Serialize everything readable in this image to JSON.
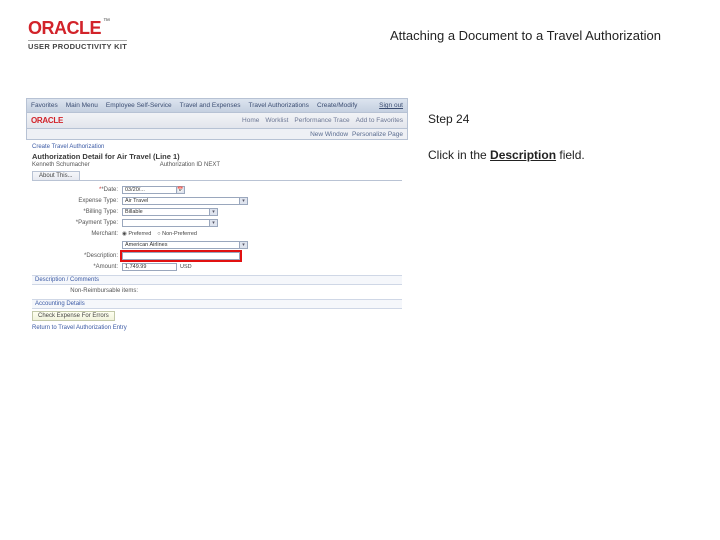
{
  "brand": {
    "name": "ORACLE",
    "tm": "™",
    "kit": "USER PRODUCTIVITY KIT"
  },
  "doc_title": "Attaching a Document to a Travel Authorization",
  "instructions": {
    "step": "Step 24",
    "line_a": "Click in the ",
    "bold": "Description",
    "line_b": " field."
  },
  "mini": {
    "topnav": {
      "favorites": "Favorites",
      "main": "Main Menu",
      "path1": "Employee Self-Service",
      "path2": "Travel and Expenses",
      "path3": "Travel Authorizations",
      "path4": "Create/Modify",
      "signout": "Sign out"
    },
    "oraclebar": {
      "oracle": "ORACLE",
      "links": [
        "Home",
        "Worklist",
        "Performance Trace",
        "Add to Favorites"
      ]
    },
    "subbar": {
      "new": "New Window",
      "pers": "Personalize Page"
    },
    "crumb": "Create Travel Authorization",
    "page_title": "Authorization Detail for Air Travel (Line 1)",
    "user_row": {
      "name": "Kenneth Schumacher",
      "right": "Authorization ID NEXT"
    },
    "tab": "About This...",
    "fields": {
      "date_lbl": "*Date:",
      "date_val": "03/20/...",
      "exp_lbl": "Expense Type:",
      "exp_val": "Air Travel",
      "bill_lbl": "*Billing Type:",
      "bill_val": "Billable",
      "pay_lbl": "*Payment Type:",
      "merch_lbl": "Merchant:",
      "merch_radio1": "Preferred",
      "merch_radio2": "Non-Preferred",
      "merch_val": "American Airlines",
      "desc_lbl": "*Description:",
      "amount_lbl": "*Amount:",
      "amount_val": "1,749.99",
      "amount_cur": "USD"
    },
    "sec1": "Description / Comments",
    "nm_lbl": "Non-Reimbursable items:",
    "sec2": "Accounting Details",
    "btn": "Check Expense For Errors",
    "foot": "Return to Travel Authorization Entry"
  }
}
